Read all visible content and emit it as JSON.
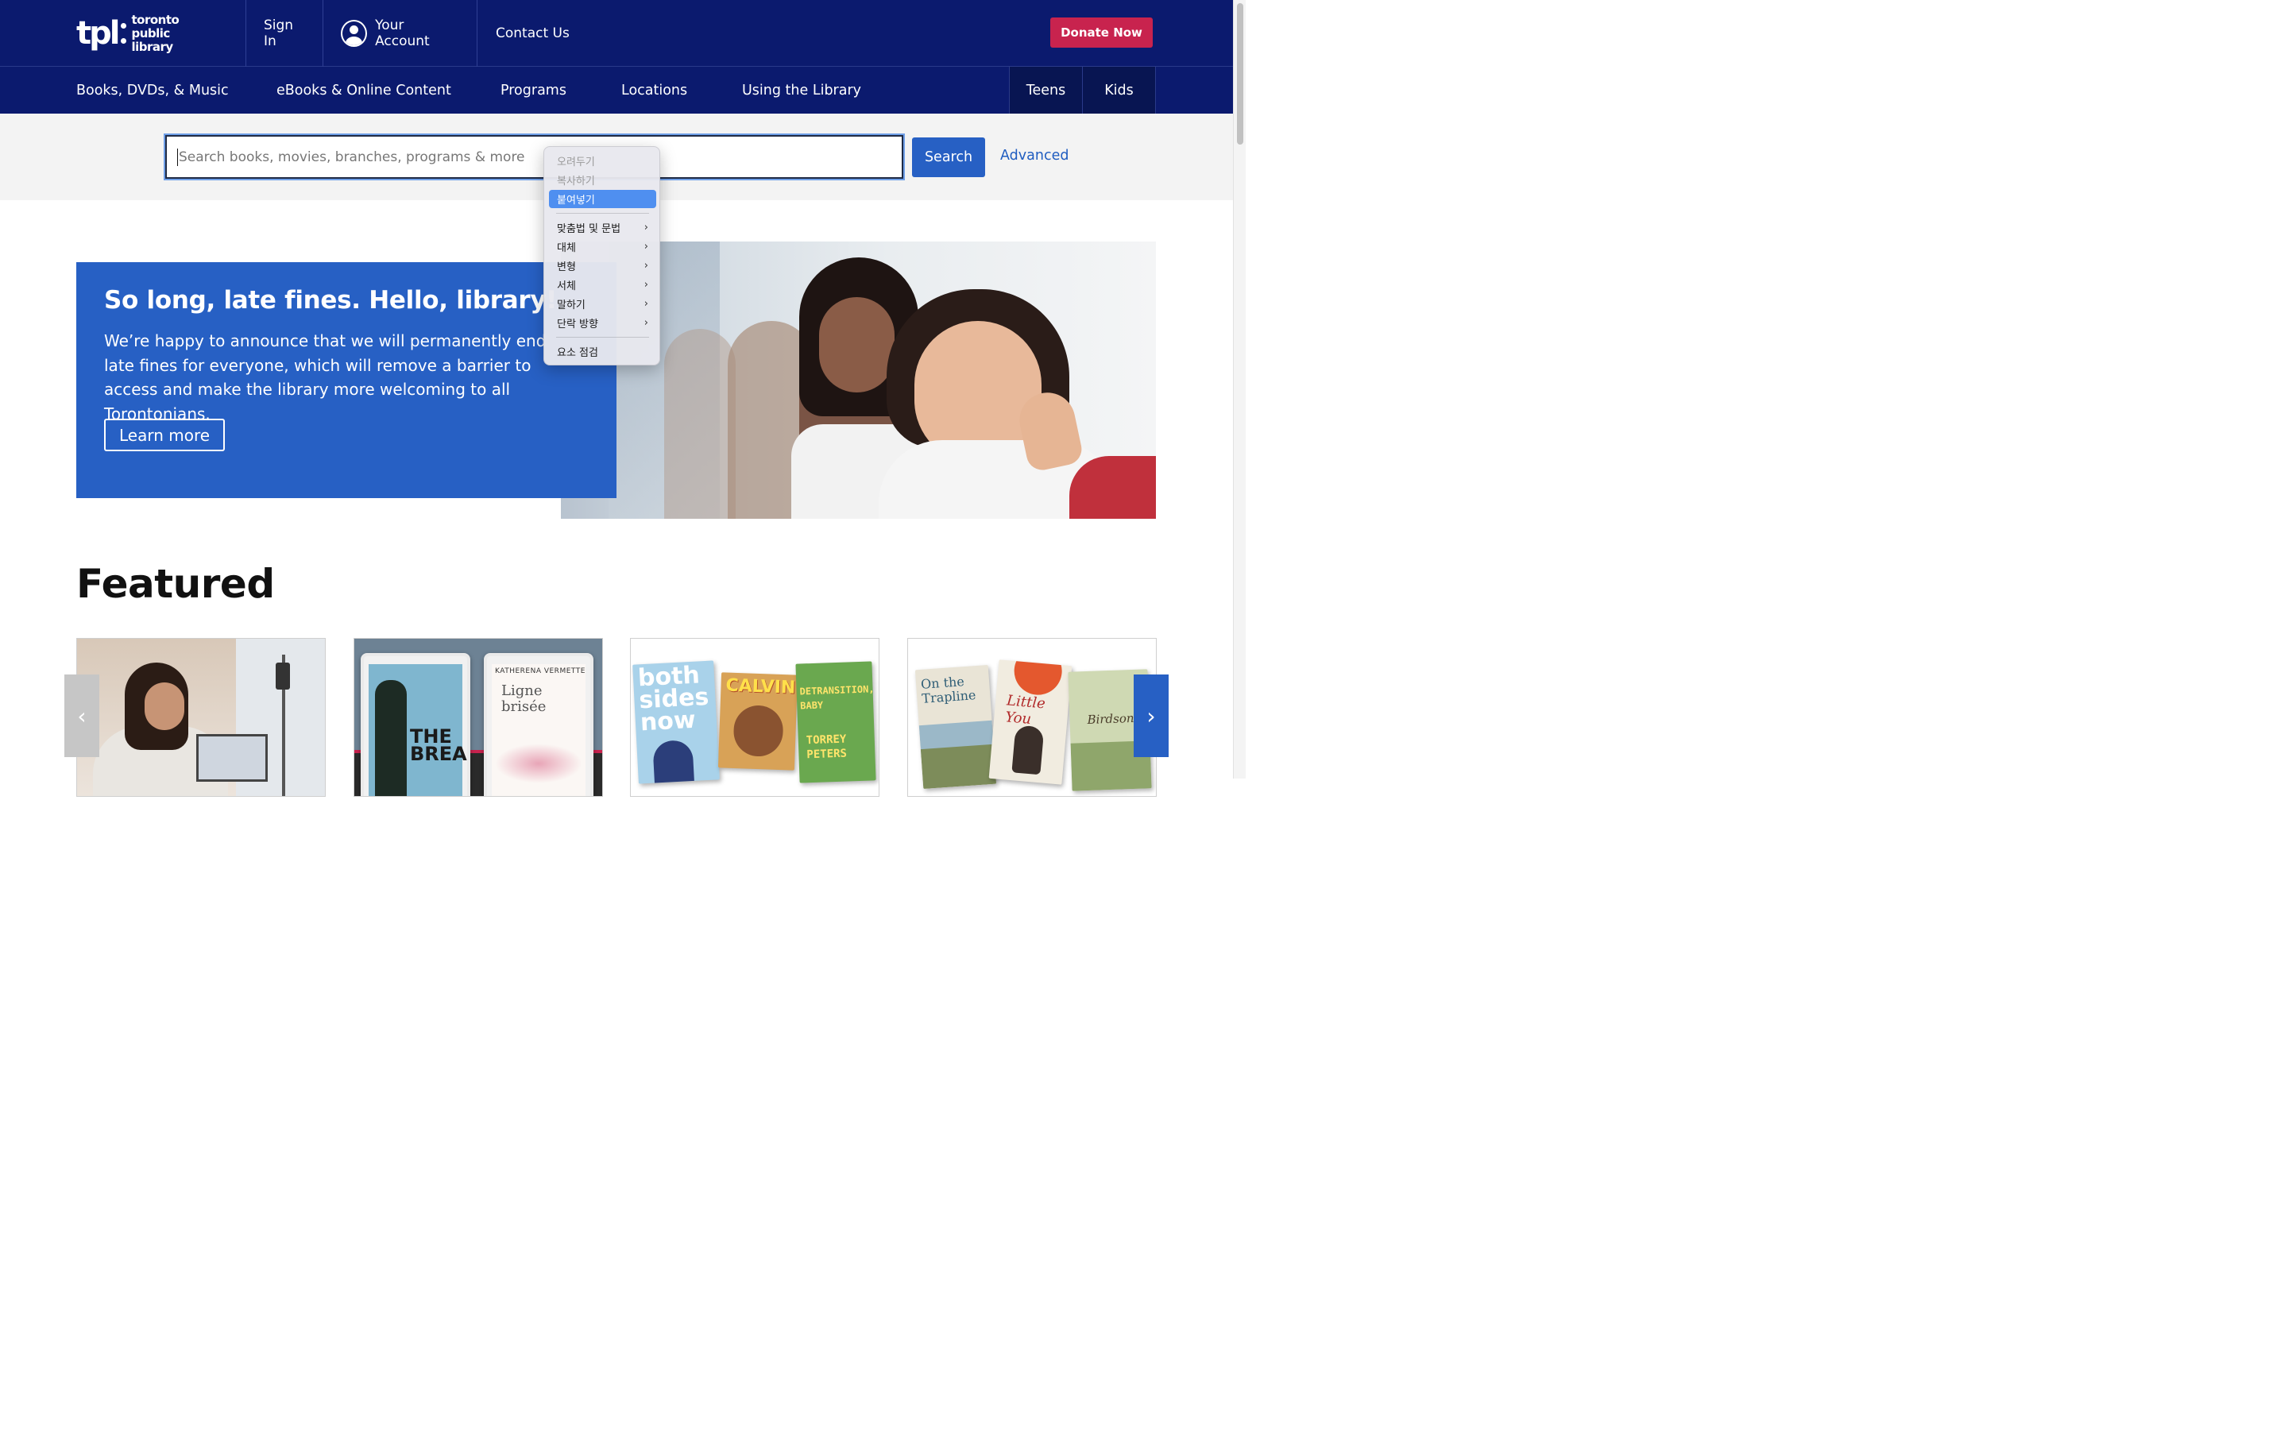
{
  "header": {
    "logo_mark": "tpl",
    "logo_line1": "toronto",
    "logo_line2": "public library",
    "sign_in": "Sign In",
    "your_account": "Your Account",
    "contact_us": "Contact Us",
    "donate": "Donate Now"
  },
  "nav": {
    "items": [
      {
        "label": "Books, DVDs, & Music"
      },
      {
        "label": "eBooks & Online Content"
      },
      {
        "label": "Programs"
      },
      {
        "label": "Locations"
      },
      {
        "label": "Using the Library"
      }
    ],
    "teens": "Teens",
    "kids": "Kids"
  },
  "search": {
    "placeholder": "Search books, movies, branches, programs & more",
    "button": "Search",
    "advanced": "Advanced"
  },
  "context_menu": {
    "items": [
      {
        "label": "오려두기",
        "disabled": true
      },
      {
        "label": "복사하기",
        "disabled": true
      },
      {
        "label": "붙여넣기",
        "highlighted": true
      },
      {
        "label": "맞춤법 및 문법",
        "submenu": true
      },
      {
        "label": "대체",
        "submenu": true
      },
      {
        "label": "변형",
        "submenu": true
      },
      {
        "label": "서체",
        "submenu": true
      },
      {
        "label": "말하기",
        "submenu": true
      },
      {
        "label": "단락 방향",
        "submenu": true
      },
      {
        "label": "요소 점검"
      }
    ],
    "chevron": "›"
  },
  "hero": {
    "title": "So long, late fines. Hello, library!",
    "body": "We’re happy to announce that we will permanently end late fines for everyone, which will remove a barrier to access and make the library more welcoming to all Torontonians.",
    "button": "Learn more"
  },
  "featured": {
    "title": "Featured",
    "prev": "‹",
    "next": "›",
    "cards": [
      {
        "covers": []
      },
      {
        "covers": [
          {
            "title": "THE BREAK"
          },
          {
            "author": "KATHERENA VERMETTE",
            "title": "Ligne brisée"
          }
        ]
      },
      {
        "covers": [
          {
            "title": "both sides now"
          },
          {
            "title": "CALVIN"
          },
          {
            "title": "DETRANSITION, BABY",
            "author": "TORREY PETERS"
          }
        ]
      },
      {
        "covers": [
          {
            "title": "On the Trapline"
          },
          {
            "title": "Little You"
          },
          {
            "title": "Birdsong"
          }
        ]
      }
    ]
  },
  "colors": {
    "navy": "#0b1a6e",
    "blue": "#2760c4",
    "donate": "#c8234e"
  }
}
